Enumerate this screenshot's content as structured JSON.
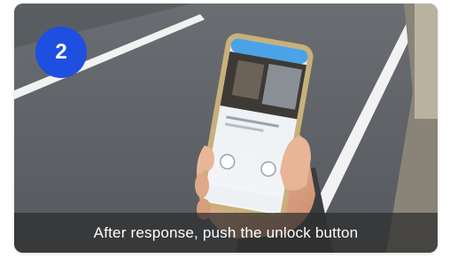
{
  "step": {
    "number": "2",
    "badge_color": "#1f4fe0"
  },
  "caption": {
    "text": "After response, push the unlock button"
  },
  "photo": {
    "scene_colors": {
      "road": "#5f6468",
      "lane_line": "#f2f2f2",
      "phone_body": "#c8b07a",
      "screen_header": "#4aa3e8",
      "hand": "#e0ab8c"
    }
  }
}
